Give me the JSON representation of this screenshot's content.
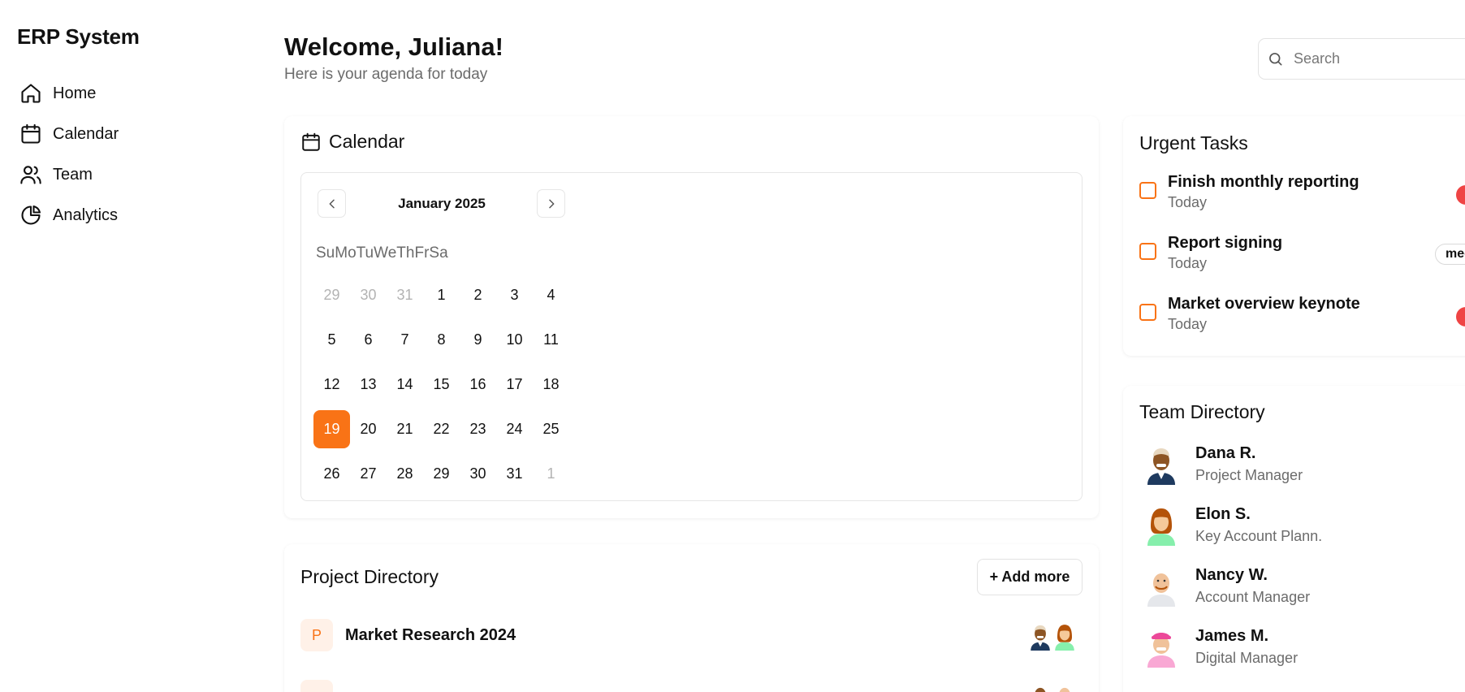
{
  "app": {
    "brand": "ERP System"
  },
  "sidebar": {
    "items": [
      {
        "label": "Home",
        "icon": "home-icon"
      },
      {
        "label": "Calendar",
        "icon": "calendar-icon"
      },
      {
        "label": "Team",
        "icon": "users-icon"
      },
      {
        "label": "Analytics",
        "icon": "pie-chart-icon"
      }
    ]
  },
  "header": {
    "title": "Welcome, Juliana!",
    "subtitle": "Here is your agenda for today",
    "search_placeholder": "Search"
  },
  "calendar": {
    "title": "Calendar",
    "month_label": "January 2025",
    "weekdays": [
      "Su",
      "Mo",
      "Tu",
      "We",
      "Th",
      "Fr",
      "Sa"
    ],
    "selected_day": "19",
    "accent_color": "#f97316",
    "weeks": [
      [
        "29",
        "30",
        "31",
        "1",
        "2",
        "3",
        "4"
      ],
      [
        "5",
        "6",
        "7",
        "8",
        "9",
        "10",
        "11"
      ],
      [
        "12",
        "13",
        "14",
        "15",
        "16",
        "17",
        "18"
      ],
      [
        "19",
        "20",
        "21",
        "22",
        "23",
        "24",
        "25"
      ],
      [
        "26",
        "27",
        "28",
        "29",
        "30",
        "31",
        "1"
      ]
    ]
  },
  "projects": {
    "title": "Project Directory",
    "add_label": "+ Add more",
    "items": [
      {
        "badge": "P",
        "name": "Market Research 2024"
      }
    ]
  },
  "urgent": {
    "title": "Urgent Tasks",
    "items": [
      {
        "name": "Finish monthly reporting",
        "date": "Today",
        "priority_color": "#ef4444"
      },
      {
        "name": "Report signing",
        "date": "Today",
        "priority_label": "med"
      },
      {
        "name": "Market overview keynote",
        "date": "Today",
        "priority_color": "#ef4444"
      }
    ]
  },
  "team": {
    "title": "Team Directory",
    "members": [
      {
        "name": "Dana R.",
        "role": "Project Manager"
      },
      {
        "name": "Elon S.",
        "role": "Key Account Plann."
      },
      {
        "name": "Nancy W.",
        "role": "Account Manager"
      },
      {
        "name": "James M.",
        "role": "Digital Manager"
      }
    ]
  }
}
